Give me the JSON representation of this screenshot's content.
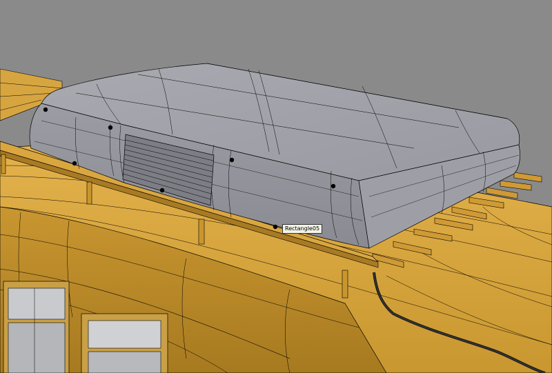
{
  "viewport": {
    "background": "#8a8a8a",
    "colors": {
      "roof": "#d9a640",
      "roof_dark": "#a87a24",
      "ac_unit": "#9a9ba2",
      "ac_top": "#a3a4ab",
      "wire": "#1a1a1a",
      "window_glass": "#c8c9cc"
    }
  },
  "selection": {
    "tooltip": "Rectangle05"
  }
}
